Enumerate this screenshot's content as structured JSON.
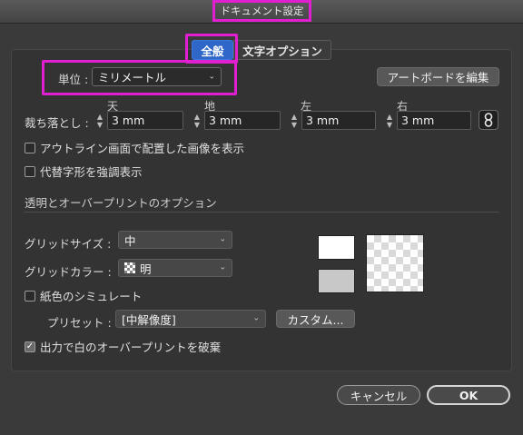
{
  "window": {
    "title": "ドキュメント設定"
  },
  "tabs": [
    {
      "label": "全般",
      "active": true
    },
    {
      "label": "文字オプション",
      "active": false
    }
  ],
  "unit": {
    "label": "単位 :",
    "value": "ミリメートル"
  },
  "artboard_button": "アートボードを編集",
  "bleed": {
    "label": "裁ち落とし :",
    "fields": [
      {
        "heading": "天",
        "value": "3 mm"
      },
      {
        "heading": "地",
        "value": "3 mm"
      },
      {
        "heading": "左",
        "value": "3 mm"
      },
      {
        "heading": "右",
        "value": "3 mm"
      }
    ]
  },
  "checkboxes": {
    "outline_images": {
      "label": "アウトライン画面で配置した画像を表示",
      "checked": false
    },
    "substituted_glyphs": {
      "label": "代替字形を強調表示",
      "checked": false
    }
  },
  "transparency": {
    "section_title": "透明とオーバープリントのオプション",
    "grid_size": {
      "label": "グリッドサイズ :",
      "value": "中"
    },
    "grid_color": {
      "label": "グリッドカラー :",
      "value": "明"
    },
    "paper_simulation": {
      "label": "紙色のシミュレート",
      "checked": false
    },
    "preset": {
      "label": "プリセット :",
      "value": "[中解像度]"
    },
    "custom_button": "カスタム...",
    "overprint_white": {
      "label": "出力で白のオーバープリントを破棄",
      "checked": true
    }
  },
  "footer": {
    "cancel": "キャンセル",
    "ok": "OK"
  },
  "colors": {
    "highlight": "#e020d0",
    "active_tab": "#2f67c8",
    "background": "#3a3a3a"
  }
}
